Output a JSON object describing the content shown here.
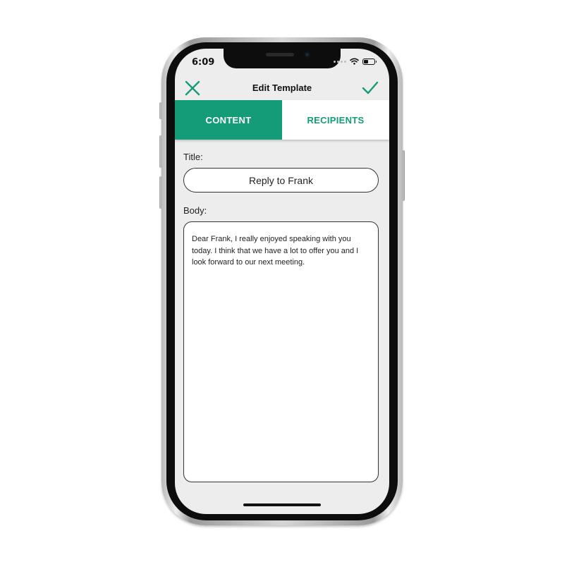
{
  "status_bar": {
    "time": "6:09",
    "icons": [
      "signal-icon",
      "wifi-icon",
      "battery-icon"
    ]
  },
  "nav": {
    "title": "Edit Template",
    "close_icon": "close-icon",
    "confirm_icon": "checkmark-icon"
  },
  "tabs": [
    {
      "label": "CONTENT",
      "active": true
    },
    {
      "label": "RECIPIENTS",
      "active": false
    }
  ],
  "form": {
    "title_label": "Title:",
    "title_value": "Reply to Frank",
    "body_label": "Body:",
    "body_value": "Dear Frank, I really enjoyed speaking with you today. I think that we have a lot to offer you and I look forward to our next meeting."
  },
  "colors": {
    "accent": "#149b77",
    "screen_background": "#ededed",
    "tab_inactive_background": "#ffffff"
  }
}
